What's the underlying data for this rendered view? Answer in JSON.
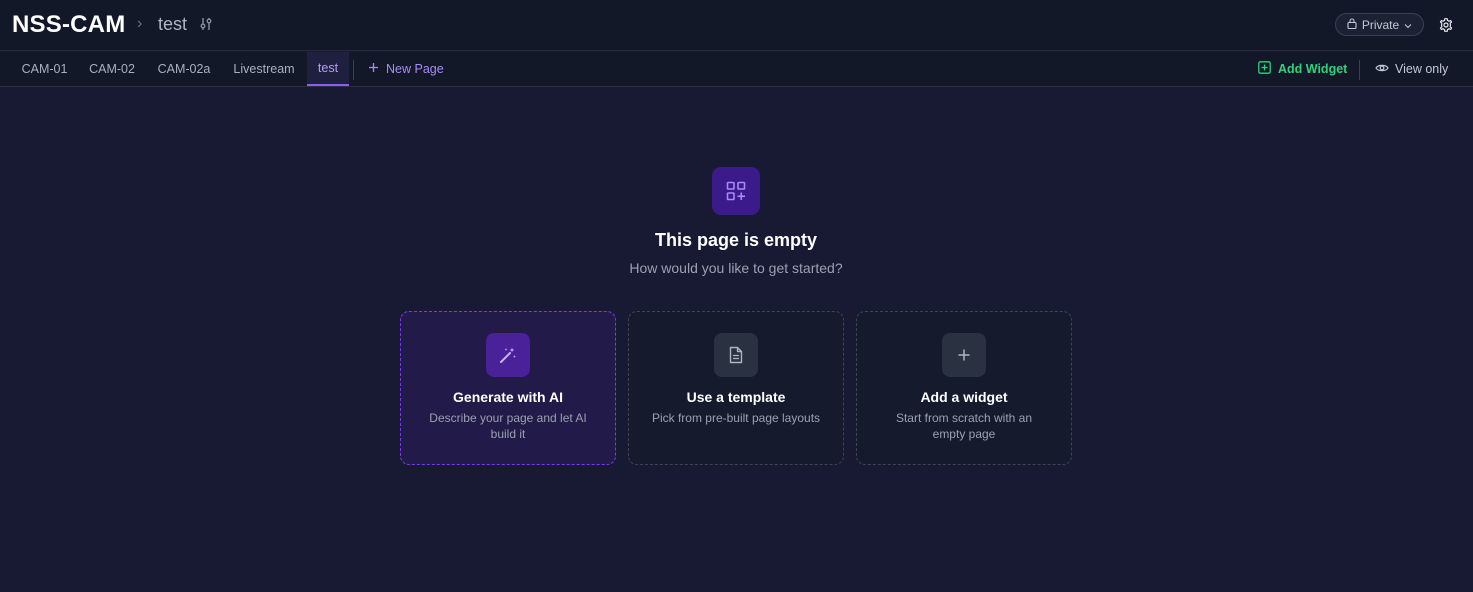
{
  "header": {
    "app_title": "NSS-CAM",
    "breadcrumb_separator": "›",
    "current_page": "test",
    "privacy": "Private",
    "icons": {
      "page_settings": "sliders-icon",
      "privacy_lock": "lock-icon",
      "privacy_chevron": "chevron-down-icon",
      "settings": "gear-icon"
    }
  },
  "tabs": [
    {
      "label": "CAM-01",
      "active": false
    },
    {
      "label": "CAM-02",
      "active": false
    },
    {
      "label": "CAM-02a",
      "active": false
    },
    {
      "label": "Livestream",
      "active": false
    },
    {
      "label": "test",
      "active": true
    }
  ],
  "toolbar": {
    "new_page": "New Page",
    "add_widget": "Add Widget",
    "view_only": "View only"
  },
  "empty_state": {
    "icon": "grid-plus-icon",
    "title": "This page is empty",
    "subtitle": "How would you like to get started?",
    "options": [
      {
        "title": "Generate with AI",
        "description": "Describe your page and let AI build it",
        "icon": "magic-wand-icon"
      },
      {
        "title": "Use a template",
        "description": "Pick from pre-built page layouts",
        "icon": "file-text-icon"
      },
      {
        "title": "Add a widget",
        "description": "Start from scratch with an empty page",
        "icon": "plus-icon"
      }
    ]
  },
  "colors": {
    "background": "#181a33",
    "header": "#131828",
    "accent_purple": "#8b5cf6",
    "add_widget_green": "#2fd27a"
  }
}
